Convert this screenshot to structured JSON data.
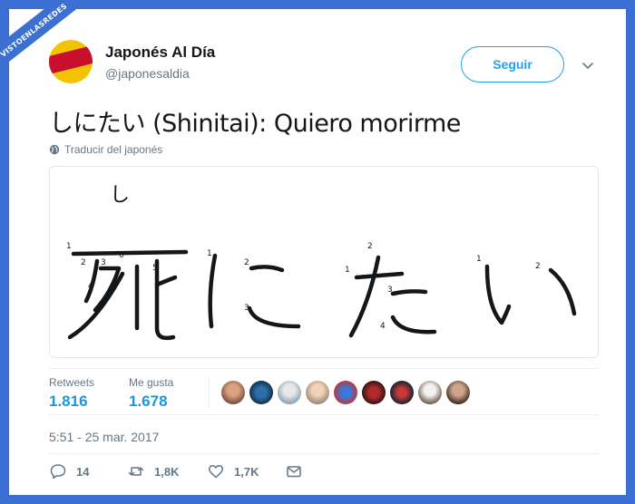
{
  "watermark": "VISTOENLASREDES",
  "header": {
    "name": "Japonés Al Día",
    "handle": "@japonesaldia",
    "follow_label": "Seguir"
  },
  "tweet": {
    "text": "しにたい (Shinitai): Quiero morirme",
    "translate_label": "Traducir del japonés"
  },
  "media": {
    "furigana": "し",
    "kanji_chars": [
      "死",
      "に",
      "た",
      "い"
    ],
    "stroke_numbers": [
      "1",
      "2",
      "3",
      "6",
      "5",
      "4",
      "1",
      "2",
      "3",
      "2",
      "1",
      "3",
      "4",
      "1",
      "2"
    ]
  },
  "stats": {
    "retweets_label": "Retweets",
    "retweets_value": "1.816",
    "likes_label": "Me gusta",
    "likes_value": "1.678"
  },
  "timestamp": "5:51 - 25 mar. 2017",
  "actions": {
    "reply_count": "14",
    "retweet_count": "1,8K",
    "like_count": "1,7K"
  },
  "colors": {
    "frame": "#3b6fd1",
    "accent": "#1da1f2",
    "stat_value": "#1b95e0"
  }
}
